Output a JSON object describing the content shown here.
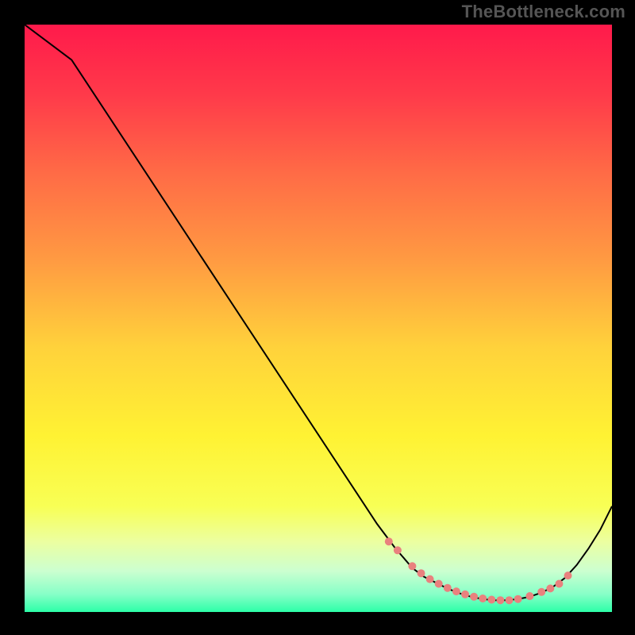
{
  "watermark": "TheBottleneck.com",
  "colors": {
    "page_bg": "#000000",
    "curve_stroke": "#000000",
    "marker_fill": "#e9817e",
    "gradient": [
      {
        "offset": 0.0,
        "color": "#ff1a4b"
      },
      {
        "offset": 0.12,
        "color": "#ff3a4a"
      },
      {
        "offset": 0.25,
        "color": "#ff6a46"
      },
      {
        "offset": 0.4,
        "color": "#ff9a42"
      },
      {
        "offset": 0.55,
        "color": "#ffd23b"
      },
      {
        "offset": 0.7,
        "color": "#fff233"
      },
      {
        "offset": 0.82,
        "color": "#f8ff55"
      },
      {
        "offset": 0.88,
        "color": "#ecffa0"
      },
      {
        "offset": 0.93,
        "color": "#ccffd0"
      },
      {
        "offset": 0.97,
        "color": "#86ffc7"
      },
      {
        "offset": 1.0,
        "color": "#2cffa8"
      }
    ]
  },
  "chart_data": {
    "type": "line",
    "title": "",
    "xlabel": "",
    "ylabel": "",
    "xlim": [
      0,
      100
    ],
    "ylim": [
      0,
      100
    ],
    "grid": false,
    "legend": false,
    "series": [
      {
        "name": "curve",
        "x": [
          0,
          8,
          60,
          63,
          66,
          68,
          70,
          72,
          74,
          76,
          78,
          80,
          82,
          84,
          86,
          88,
          90,
          92,
          94,
          96,
          98,
          100
        ],
        "y": [
          100,
          94,
          15,
          11,
          7.5,
          6,
          5,
          4,
          3.2,
          2.6,
          2.2,
          2,
          2,
          2.2,
          2.6,
          3.3,
          4.3,
          5.8,
          8,
          10.8,
          14,
          18
        ]
      }
    ],
    "markers": {
      "name": "highlight-points",
      "x": [
        62,
        63.5,
        66,
        67.5,
        69,
        70.5,
        72,
        73.5,
        75,
        76.5,
        78,
        79.5,
        81,
        82.5,
        84,
        86,
        88,
        89.5,
        91,
        92.5
      ],
      "y": [
        12,
        10.5,
        7.8,
        6.6,
        5.6,
        4.8,
        4.1,
        3.5,
        3.0,
        2.6,
        2.3,
        2.1,
        2.0,
        2.0,
        2.2,
        2.7,
        3.4,
        4.0,
        4.8,
        6.2
      ]
    }
  }
}
